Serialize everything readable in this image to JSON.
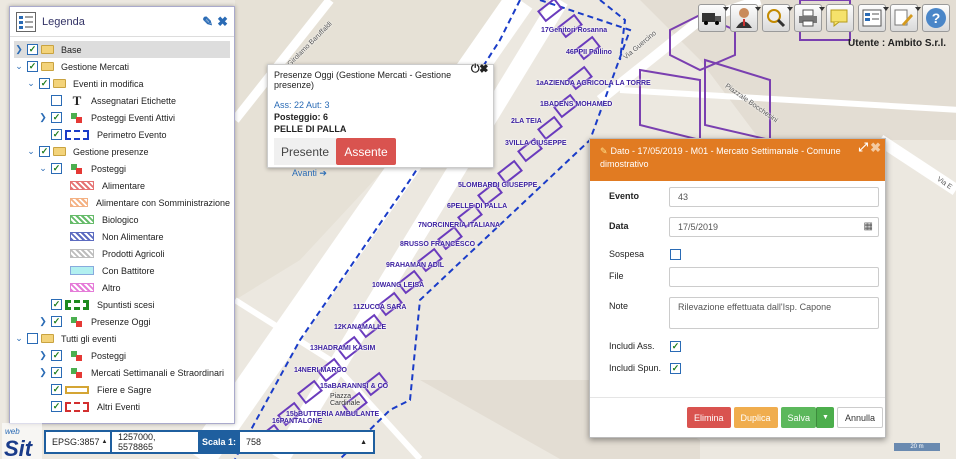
{
  "toolbar": {
    "icons": [
      "truck-icon",
      "user-icon",
      "zoom-icon",
      "print-icon",
      "note-icon",
      "table-icon",
      "edit-icon",
      "help-icon"
    ],
    "user_text": "Utente : Ambito S.r.l."
  },
  "legend": {
    "title": "Legenda",
    "items": [
      {
        "label": "Base"
      },
      {
        "label": "Gestione Mercati"
      },
      {
        "label": "Eventi in modifica"
      },
      {
        "label": "Assegnatari Etichette"
      },
      {
        "label": "Posteggi Eventi Attivi"
      },
      {
        "label": "Perimetro Evento"
      },
      {
        "label": "Gestione presenze"
      },
      {
        "label": "Posteggi"
      },
      {
        "label": "Alimentare"
      },
      {
        "label": "Alimentare con Somministrazione"
      },
      {
        "label": "Biologico"
      },
      {
        "label": "Non Alimentare"
      },
      {
        "label": "Prodotti Agricoli"
      },
      {
        "label": "Con Battitore"
      },
      {
        "label": "Altro"
      },
      {
        "label": "Spuntisti scesi"
      },
      {
        "label": "Presenze Oggi"
      },
      {
        "label": "Tutti gli eventi"
      },
      {
        "label": "Posteggi"
      },
      {
        "label": "Mercati Settimanali e Straordinari"
      },
      {
        "label": "Fiere e Sagre"
      },
      {
        "label": "Altri Eventi"
      }
    ]
  },
  "popup": {
    "title": "Presenze Oggi (Gestione Mercati - Gestione presenze)",
    "ass": "Ass: 22 Aut: 3",
    "posteggio": "Posteggio: 6",
    "name": "PELLE DI PALLA",
    "presente": "Presente",
    "assente": "Assente",
    "avanti": "Avanti ➔"
  },
  "dialog": {
    "title": "Dato - 17/05/2019 - M01 - Mercato Settimanale - Comune dimostrativo",
    "evento_label": "Evento",
    "evento_value": "43",
    "data_label": "Data",
    "data_value": "17/5/2019",
    "sospesa_label": "Sospesa",
    "file_label": "File",
    "note_label": "Note",
    "note_value": "Rilevazione effettuata dall'Isp. Capone",
    "includi_ass_label": "Includi Ass.",
    "includi_spun_label": "Includi Spun.",
    "btn_elimina": "Elimina",
    "btn_duplica": "Duplica",
    "btn_salva": "Salva",
    "btn_annulla": "Annulla"
  },
  "bottom": {
    "epsg": "EPSG:3857",
    "coords": "1257000, 5578865",
    "scala_label": "Scala 1:",
    "scala_value": "758",
    "scale_line": "20 m"
  },
  "map": {
    "labels": [
      "17Genitori Rosanna",
      "46PPII Pallino",
      "1aAZIENDA AGRICOLA LA TORRE",
      "1BADENS MOHAMED",
      "2LA TEIA",
      "3VILLA GIUSEPPE",
      "5LOMBARDI GIUSEPPE",
      "6PELLE DI PALLA",
      "7NORCINERIA ITALIANA",
      "8RUSSO FRANCESCO",
      "9RAHAMAN ADIL",
      "10WANG LEISA",
      "11ZUCCA SARA",
      "12KANAMALLE",
      "13HADRAMI KASIM",
      "14NERI MARCO",
      "15aBARANNSI & CO",
      "15bBUTTERIA AMBULANTE",
      "16PANTALONE",
      "Piazza Cardinale"
    ],
    "streets": [
      "Via Girolamo Baruffaldi",
      "Via Guercino",
      "Piazzale Bocchesini",
      "Via E"
    ],
    "colors": {
      "perimeter": "#1a3cc8",
      "stall": "#6a3bbd",
      "road": "#ffffff",
      "ground": "#ece8e0"
    }
  }
}
